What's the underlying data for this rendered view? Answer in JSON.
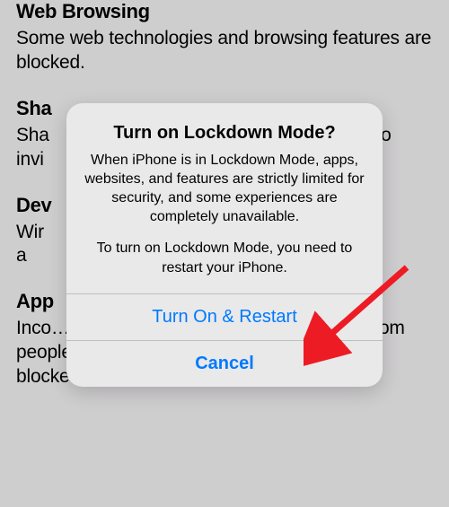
{
  "background": {
    "sections": [
      {
        "title": "Web Browsing",
        "body": "Some web technologies and browsing features are blocked."
      },
      {
        "title": "Sha",
        "body": "Sha                                                        he Pho\ninvi"
      },
      {
        "title": "Dev",
        "body": "Wir                                                          e or a                                                      ed are"
      },
      {
        "title": "App",
        "body": "Inco…… …………… … …pp… …………s from people you have not previously invited are blocked."
      }
    ]
  },
  "alert": {
    "title": "Turn on Lockdown Mode?",
    "body1": "When iPhone is in Lockdown Mode, apps, websites, and features are strictly limited for security, and some experiences are completely unavailable.",
    "body2": "To turn on Lockdown Mode, you need to restart your iPhone.",
    "confirm": "Turn On & Restart",
    "cancel": "Cancel"
  },
  "annotation": {
    "arrow_color": "#ed1c24"
  }
}
